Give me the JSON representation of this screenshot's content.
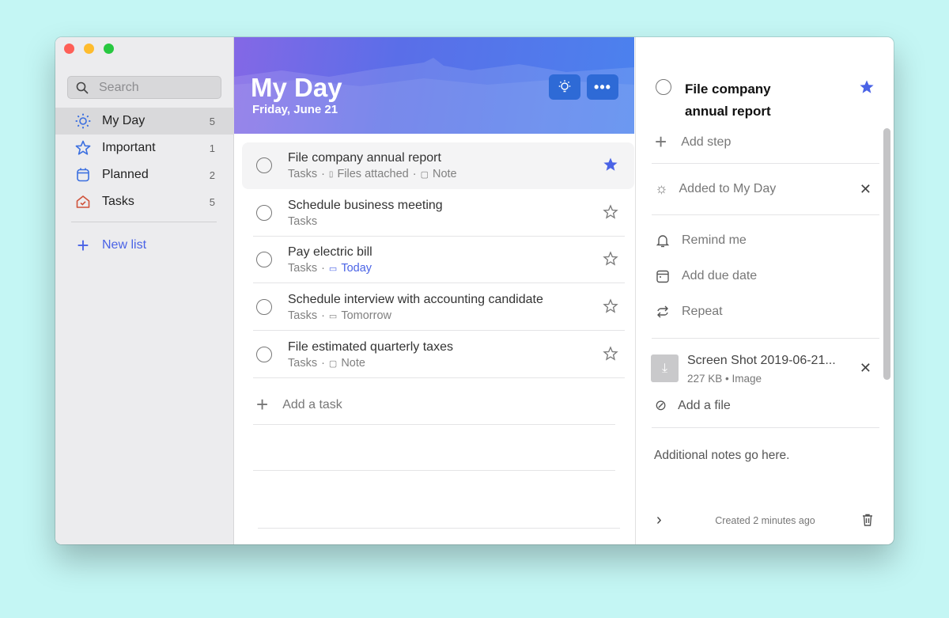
{
  "sidebar": {
    "search_placeholder": "Search",
    "items": [
      {
        "label": "My Day",
        "count": "5"
      },
      {
        "label": "Important",
        "count": "1"
      },
      {
        "label": "Planned",
        "count": "2"
      },
      {
        "label": "Tasks",
        "count": "5"
      }
    ],
    "new_list": "New list"
  },
  "main": {
    "title": "My Day",
    "date": "Friday, June 21",
    "add_task": "Add a task",
    "tasks": [
      {
        "title": "File company annual report",
        "list": "Tasks",
        "files": "Files attached",
        "note": "Note",
        "important": true
      },
      {
        "title": "Schedule business meeting",
        "list": "Tasks",
        "important": false
      },
      {
        "title": "Pay electric bill",
        "list": "Tasks",
        "due": "Today",
        "important": false
      },
      {
        "title": "Schedule interview with accounting candidate",
        "list": "Tasks",
        "due": "Tomorrow",
        "important": false
      },
      {
        "title": "File estimated quarterly taxes",
        "list": "Tasks",
        "note": "Note",
        "important": false
      }
    ]
  },
  "detail": {
    "title_line1": "File company",
    "title_line2": "annual report",
    "add_step": "Add step",
    "my_day": "Added to My Day",
    "remind": "Remind me",
    "due": "Add due date",
    "repeat": "Repeat",
    "file_name": "Screen Shot 2019-06-21...",
    "file_meta": "227 KB • Image",
    "add_file": "Add a file",
    "notes": "Additional notes go here.",
    "created": "Created 2 minutes ago"
  },
  "colors": {
    "accent": "#4a63e6",
    "star": "#4a63e6"
  }
}
